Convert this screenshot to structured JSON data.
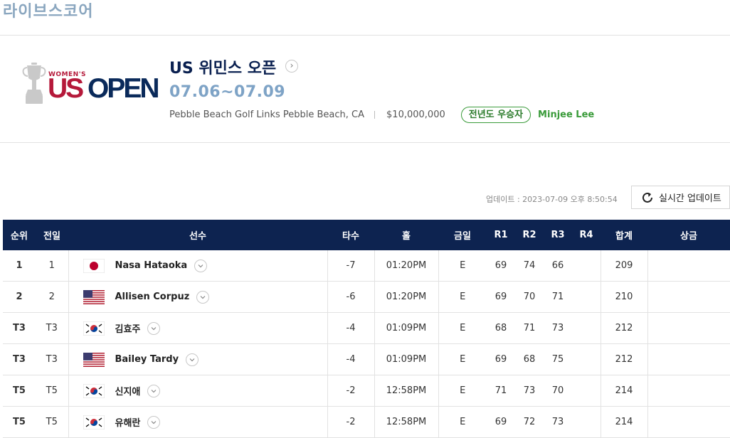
{
  "page": {
    "title": "라이브스코어"
  },
  "tournament": {
    "logo_small": "WOMEN'S",
    "logo_us": "US",
    "logo_open": "OPEN",
    "name": "US 위민스 오픈",
    "dates": "07.06~07.09",
    "venue": "Pebble Beach Golf Links Pebble Beach, CA",
    "prize": "$10,000,000",
    "champion_label": "전년도 우승자",
    "champion_name": "Minjee Lee"
  },
  "update": {
    "time": "업데이트 : 2023-07-09 오후 8:50:54",
    "button_label": "실시간 업데이트"
  },
  "table": {
    "headers": {
      "rank": "순위",
      "prev": "전일",
      "player": "선수",
      "score": "타수",
      "hole": "홀",
      "today": "금일",
      "r1": "R1",
      "r2": "R2",
      "r3": "R3",
      "r4": "R4",
      "total": "합계",
      "prize": "상금"
    },
    "rows": [
      {
        "rank": "1",
        "prev": "1",
        "flag": "jp-flag-icon",
        "name": "Nasa Hataoka",
        "score": "-7",
        "hole": "01:20PM",
        "today": "E",
        "r1": "69",
        "r2": "74",
        "r3": "66",
        "r4": "",
        "total": "209",
        "prize": ""
      },
      {
        "rank": "2",
        "prev": "2",
        "flag": "us-flag-icon",
        "name": "Allisen Corpuz",
        "score": "-6",
        "hole": "01:20PM",
        "today": "E",
        "r1": "69",
        "r2": "70",
        "r3": "71",
        "r4": "",
        "total": "210",
        "prize": ""
      },
      {
        "rank": "T3",
        "prev": "T3",
        "flag": "kr-flag-icon",
        "name": "김효주",
        "score": "-4",
        "hole": "01:09PM",
        "today": "E",
        "r1": "68",
        "r2": "71",
        "r3": "73",
        "r4": "",
        "total": "212",
        "prize": ""
      },
      {
        "rank": "T3",
        "prev": "T3",
        "flag": "us-flag-icon",
        "name": "Bailey Tardy",
        "score": "-4",
        "hole": "01:09PM",
        "today": "E",
        "r1": "69",
        "r2": "68",
        "r3": "75",
        "r4": "",
        "total": "212",
        "prize": ""
      },
      {
        "rank": "T5",
        "prev": "T5",
        "flag": "kr-flag-icon",
        "name": "신지애",
        "score": "-2",
        "hole": "12:58PM",
        "today": "E",
        "r1": "71",
        "r2": "73",
        "r3": "70",
        "r4": "",
        "total": "214",
        "prize": ""
      },
      {
        "rank": "T5",
        "prev": "T5",
        "flag": "kr-flag-icon",
        "name": "유해란",
        "score": "-2",
        "hole": "12:58PM",
        "today": "E",
        "r1": "69",
        "r2": "72",
        "r3": "73",
        "r4": "",
        "total": "214",
        "prize": ""
      }
    ]
  },
  "colors": {
    "header_bg": "#0d2350",
    "title_blue": "#8aa6bf",
    "dates_blue": "#7ea3c6",
    "green": "#3a9b3a",
    "logo_red": "#b5193a",
    "logo_navy": "#0a2a5a"
  }
}
